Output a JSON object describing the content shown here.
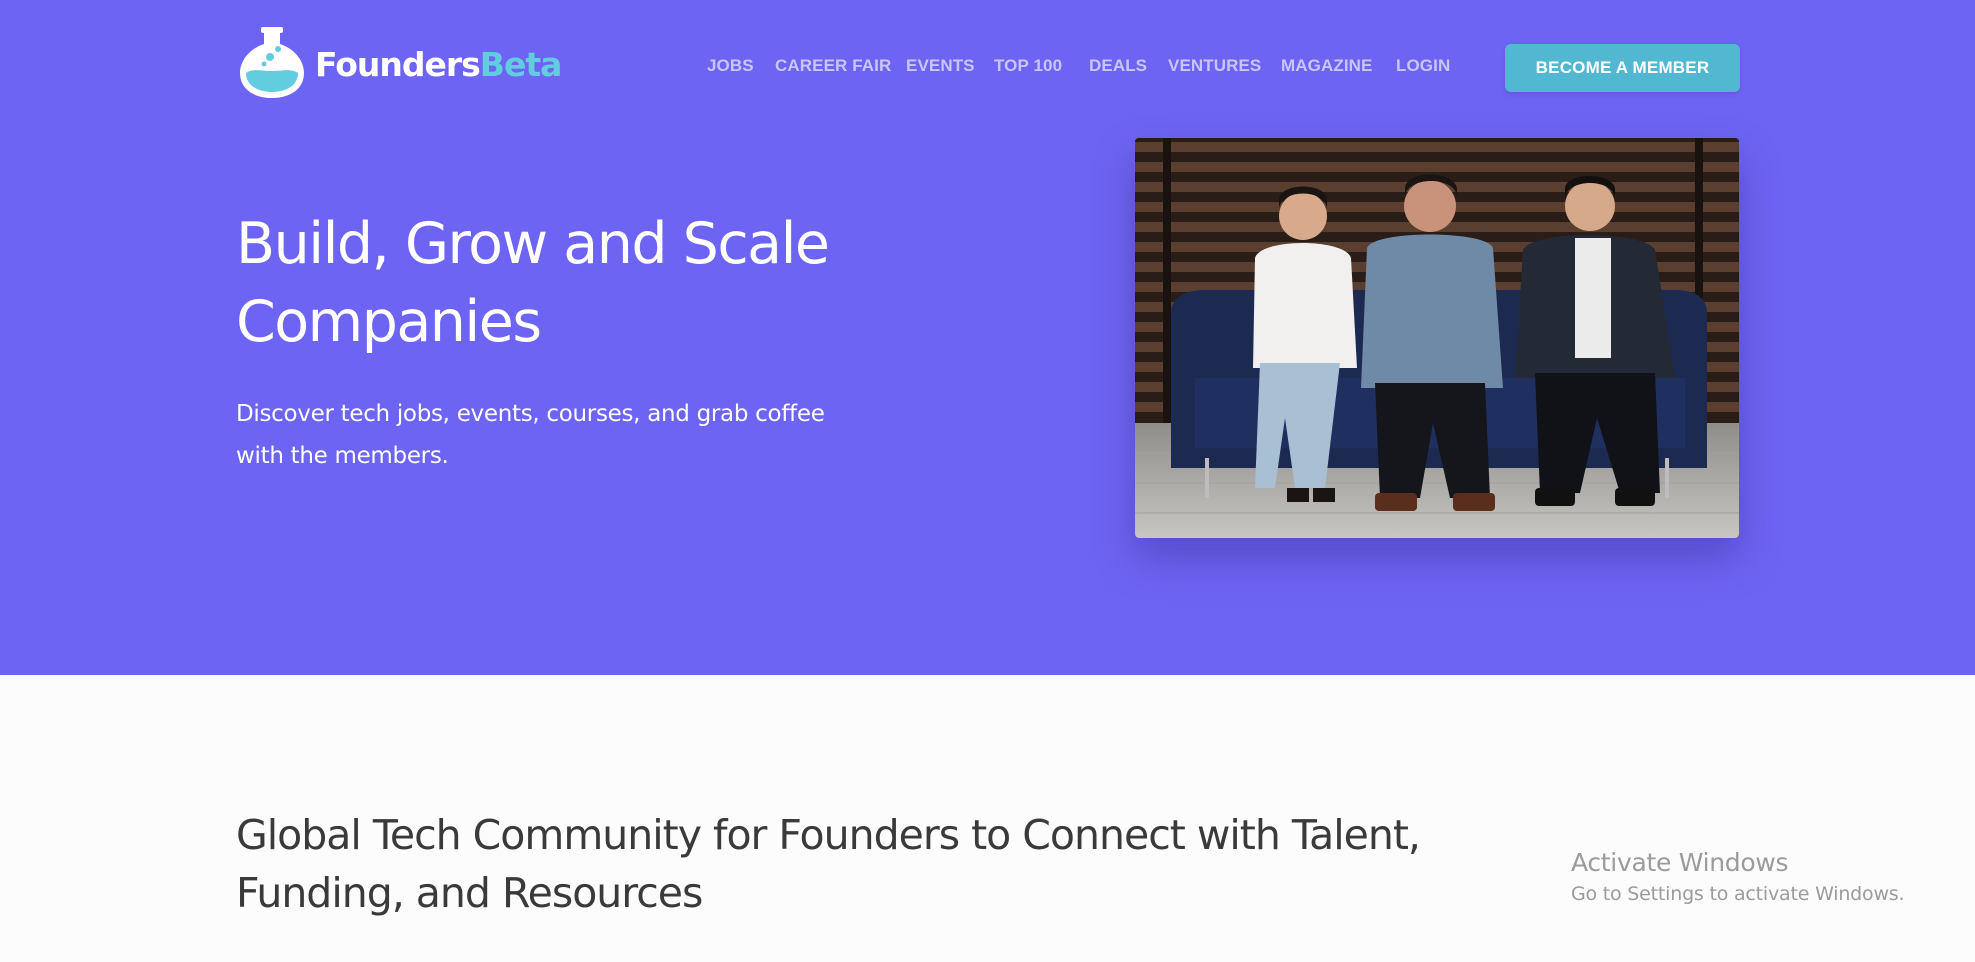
{
  "brand": {
    "name_part1": "Founders",
    "name_part2": "Beta",
    "logo_icon": "flask-icon"
  },
  "nav": {
    "items": [
      "JOBS",
      "CAREER FAIR",
      "EVENTS",
      "TOP 100",
      "DEALS",
      "VENTURES",
      "MAGAZINE",
      "LOGIN"
    ],
    "cta_label": "BECOME A MEMBER"
  },
  "hero": {
    "headline_line1": "Build, Grow and Scale",
    "headline_line2": "Companies",
    "subline_line1": "Discover tech jobs, events, courses, and grab coffee",
    "subline_line2": "with the members."
  },
  "section": {
    "heading_line1": "Global Tech Community for Founders to Connect with Talent,",
    "heading_line2": "Funding, and Resources"
  },
  "watermark": {
    "title": "Activate Windows",
    "subtitle": "Go to Settings to activate Windows."
  },
  "colors": {
    "hero_bg": "#6e64f3",
    "accent": "#52b8d1",
    "brand_secondary": "#63cde0",
    "nav_text": "#c9c6f7"
  }
}
